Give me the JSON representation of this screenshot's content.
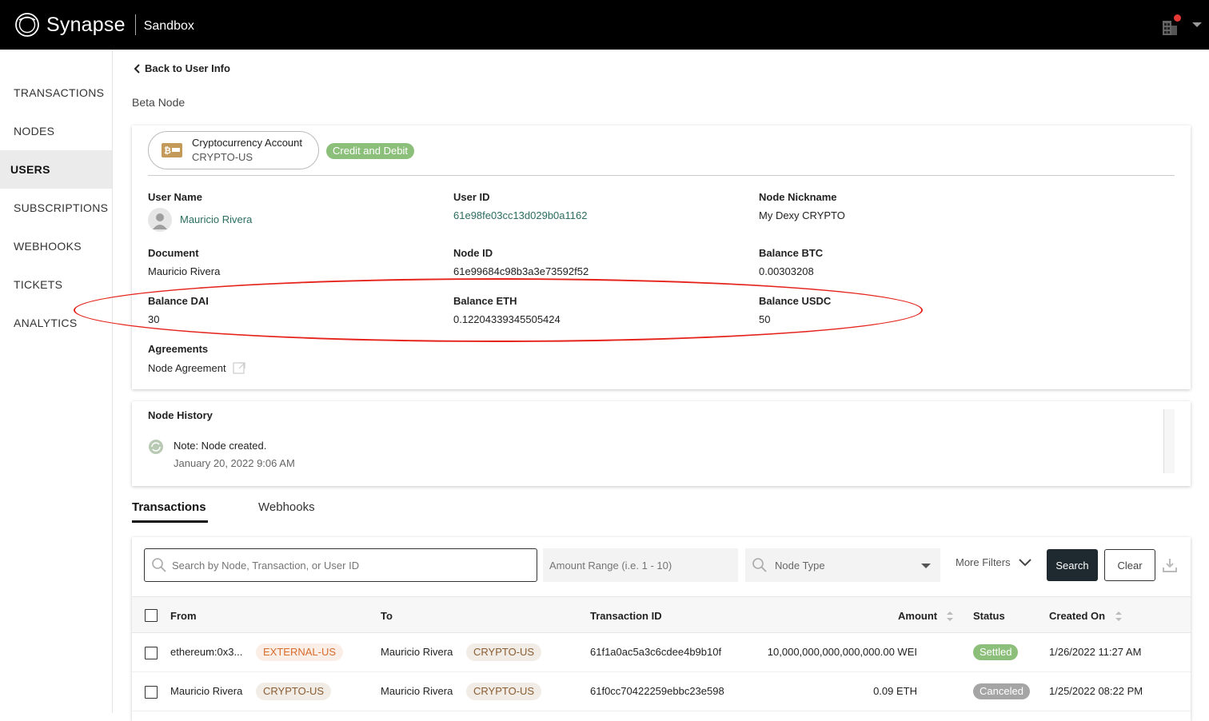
{
  "app": {
    "brand": "Synapse",
    "environment": "Sandbox"
  },
  "sidebar": {
    "items": [
      {
        "label": "TRANSACTIONS",
        "active": false
      },
      {
        "label": "NODES",
        "active": false
      },
      {
        "label": "USERS",
        "active": true
      },
      {
        "label": "SUBSCRIPTIONS",
        "active": false
      },
      {
        "label": "WEBHOOKS",
        "active": false
      },
      {
        "label": "TICKETS",
        "active": false
      },
      {
        "label": "ANALYTICS",
        "active": false
      }
    ]
  },
  "nav": {
    "back_label": "Back to User Info",
    "page_subtitle": "Beta Node"
  },
  "account": {
    "type_name": "Cryptocurrency Account",
    "type_code": "CRYPTO-US",
    "permission_tag": "Credit and Debit"
  },
  "fields": {
    "user_name": {
      "label": "User Name",
      "value": "Mauricio Rivera"
    },
    "user_id": {
      "label": "User ID",
      "value": "61e98fe03cc13d029b0a1162"
    },
    "node_nickname": {
      "label": "Node Nickname",
      "value": "My Dexy CRYPTO"
    },
    "document": {
      "label": "Document",
      "value": "Mauricio Rivera"
    },
    "node_id": {
      "label": "Node ID",
      "value": "61e99684c98b3a3e73592f52"
    },
    "balance_btc": {
      "label": "Balance BTC",
      "value": "0.00303208"
    },
    "balance_dai": {
      "label": "Balance DAI",
      "value": "30"
    },
    "balance_eth": {
      "label": "Balance ETH",
      "value": "0.12204339345505424"
    },
    "balance_usdc": {
      "label": "Balance USDC",
      "value": "50"
    },
    "agreements": {
      "label": "Agreements",
      "value": "Node Agreement"
    }
  },
  "history": {
    "title": "Node History",
    "entries": [
      {
        "note": "Note: Node created.",
        "timestamp": "January 20, 2022 9:06 AM"
      }
    ]
  },
  "tabs": [
    {
      "label": "Transactions",
      "active": true
    },
    {
      "label": "Webhooks",
      "active": false
    }
  ],
  "filters": {
    "search_placeholder": "Search by Node, Transaction, or User ID",
    "amount_placeholder": "Amount Range (i.e. 1 - 10)",
    "node_type_placeholder": "Node Type",
    "more_filters_label": "More Filters",
    "search_button": "Search",
    "clear_button": "Clear"
  },
  "table": {
    "columns": {
      "from": "From",
      "to": "To",
      "transaction_id": "Transaction ID",
      "amount": "Amount",
      "status": "Status",
      "created_on": "Created On"
    },
    "rows": [
      {
        "from": "ethereum:0x3...",
        "from_tag": "EXTERNAL-US",
        "to": "Mauricio Rivera",
        "to_tag": "CRYPTO-US",
        "transaction_id": "61f1a0ac5a3c6cdee4b9b10f",
        "amount": "10,000,000,000,000,000.00 WEI",
        "status": "Settled",
        "created_on": "1/26/2022 11:27 AM"
      },
      {
        "from": "Mauricio Rivera",
        "from_tag": "CRYPTO-US",
        "to": "Mauricio Rivera",
        "to_tag": "CRYPTO-US",
        "transaction_id": "61f0cc70422259ebbc23e598",
        "amount": "0.09 ETH",
        "status": "Canceled",
        "created_on": "1/25/2022 08:22 PM"
      }
    ]
  },
  "colors": {
    "topbar": "#000000",
    "accent_green": "#8cbf7a",
    "link_teal": "#2b6d5e",
    "annotation_red": "#e5231b",
    "external_tag": "#d76c2c"
  }
}
